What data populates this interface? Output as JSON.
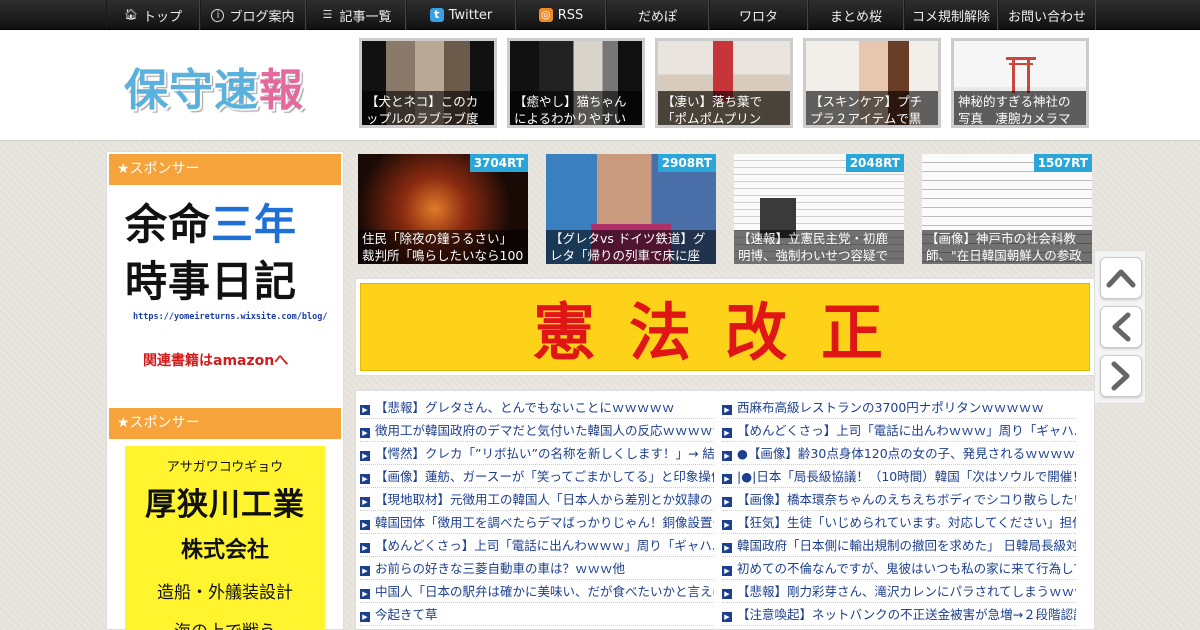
{
  "nav": {
    "items": [
      {
        "label": "トップ",
        "icon": "home-icon"
      },
      {
        "label": "ブログ案内",
        "icon": "info-icon"
      },
      {
        "label": "記事一覧",
        "icon": "list-icon"
      },
      {
        "label": "Twitter",
        "icon": "twitter-icon"
      },
      {
        "label": "RSS",
        "icon": "rss-icon"
      },
      {
        "label": "だめぽ",
        "icon": ""
      },
      {
        "label": "ワロタ",
        "icon": ""
      },
      {
        "label": "まとめ桜",
        "icon": ""
      },
      {
        "label": "コメ規制解除",
        "icon": ""
      },
      {
        "label": "お問い合わせ",
        "icon": ""
      }
    ]
  },
  "header": {
    "logo_part1": "保守速",
    "logo_part2": "報",
    "thumbs": [
      {
        "caption": "【犬とネコ】このカップルのラブラブ度"
      },
      {
        "caption": "【癒やし】猫ちゃんによるわかりやすい"
      },
      {
        "caption": "【凄い】落ち葉で「ポムポムプリン"
      },
      {
        "caption": "【スキンケア】プチプラ２アイテムで黒"
      },
      {
        "caption": "神秘的すぎる神社の写真　凄腕カメラマ"
      }
    ]
  },
  "sidebar": {
    "sponsor_label": "★スポンサー",
    "ad1": {
      "line1a": "余命",
      "line1b": "三年",
      "line2": "時事日記",
      "url": "https://yomeireturns.wixsite.com/blog/",
      "amazon": "関連書籍はamazonへ"
    },
    "sponsor_label2": "★スポンサー",
    "ad2": {
      "kana": "アサガワコウギョウ",
      "company": "厚狭川工業",
      "kk": "株式会社",
      "biz": "造船・外艤装設計",
      "more": "海の上で戦う"
    }
  },
  "ranking": [
    {
      "rt": "3704RT",
      "caption": "住民「除夜の鐘うるさい」裁判所「鳴らしたいなら100"
    },
    {
      "rt": "2908RT",
      "caption": "【グレタvs ドイツ鉄道】グレタ「帰りの列車で床に座"
    },
    {
      "rt": "2048RT",
      "caption": "【速報】立憲民主党・初鹿明博、強制わいせつ容疑で"
    },
    {
      "rt": "1507RT",
      "caption": "【画像】神戸市の社会科教師、\"在日韓国朝鮮人の参政"
    }
  ],
  "banner": {
    "text": "憲法改正"
  },
  "links": {
    "left": [
      "【悲報】グレタさん、とんでもないことにｗｗｗｗｗ",
      "徴用工が韓国政府のデマだと気付いた韓国人の反応ｗｗｗｗｗ",
      "【愕然】クレカ「”リボ払い”の名称を新しくします！」→ 結果",
      "【画像】蓮舫、ガースーが「笑ってごまかしてる」と印象操作",
      "【現地取材】元徴用工の韓国人「日本人から差別とか奴隷のよう",
      "韓国団体「徴用工を調べたらデマばっかりじゃん！銅像設置や",
      "【めんどくさっ】上司「電話に出んわｗｗｗ」周り「ギャハハ",
      "お前らの好きな三菱自動車の車は？ｗｗｗ他",
      "中国人「日本の駅弁は確かに美味い、だが食べたいかと言えば",
      "今起きて草"
    ],
    "right": [
      "西麻布高級レストランの3700円ナポリタンｗｗｗｗｗ",
      "【めんどくさっ】上司「電話に出んわｗｗｗ」周り「ギャハハ",
      "●【画像】齢30点身体120点の女の子、発見されるｗｗｗｗ",
      "|●|日本「局長級協議！（10時間）韓国「次はソウルで開催！（",
      "【画像】橋本環奈ちゃんのえちえちボディでシコり散らしたい",
      "【狂気】生徒「いじめられています。対応してください」担任",
      "韓国政府「日本側に輸出規制の撤回を求めた」 日韓局長級対話",
      "初めての不倫なんですが、鬼彼はいつも私の家に来て行為して",
      "【悲報】剛力彩芽さん、滝沢カレンにパラされてしまうｗｗｗ",
      "【注意喚起】ネットバンクの不正送金被害が急増→２段階認証"
    ]
  },
  "sidenav": {
    "buttons": [
      "up-arrow-icon",
      "prev-arrow-icon",
      "next-arrow-icon"
    ]
  },
  "colors": {
    "sponsor_header": "#f6a33c",
    "rt_badge": "#2aa6d8",
    "link": "#1d3f8f",
    "logo_blue": "#5bb1de",
    "logo_pink": "#e46a9d",
    "banner_bg": "#ffd21a",
    "banner_text": "#e01515"
  }
}
